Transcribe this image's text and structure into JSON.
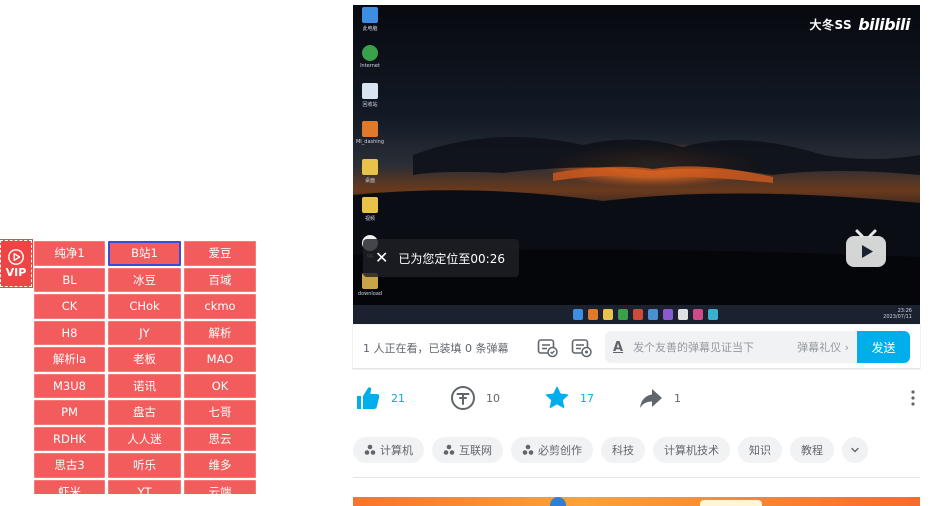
{
  "parser": {
    "vip_label": "VIP",
    "buttons": [
      "纯净1",
      "B站1",
      "爱豆",
      "BL",
      "冰豆",
      "百域",
      "CK",
      "CHok",
      "ckmo",
      "H8",
      "JY",
      "解析",
      "解析la",
      "老板",
      "MAO",
      "M3U8",
      "诺讯",
      "OK",
      "PM",
      "盘古",
      "七哥",
      "RDHK",
      "人人迷",
      "思云",
      "思古3",
      "听乐",
      "维多",
      "虾米",
      "YT",
      "云端"
    ],
    "active_index": 1,
    "accent": "#ef4444"
  },
  "player": {
    "watermark_user": "大冬SS",
    "watermark_logo": "bilibili",
    "toast_message": "已为您定位至00:26"
  },
  "danmaku": {
    "info": "1 人正在看，已装填 0 条弹幕",
    "placeholder": "发个友善的弹幕见证当下",
    "etiquette": "弹幕礼仪 ›",
    "send_label": "发送",
    "send_color": "#00aeec"
  },
  "actions": {
    "like_count": "21",
    "coin_count": "10",
    "favorite_count": "17",
    "share_count": "1"
  },
  "tags": [
    {
      "label": "计算机",
      "icon": true
    },
    {
      "label": "互联网",
      "icon": true
    },
    {
      "label": "必剪创作",
      "icon": true
    },
    {
      "label": "科技",
      "icon": false
    },
    {
      "label": "计算机技术",
      "icon": false
    },
    {
      "label": "知识",
      "icon": false
    },
    {
      "label": "教程",
      "icon": false
    }
  ]
}
